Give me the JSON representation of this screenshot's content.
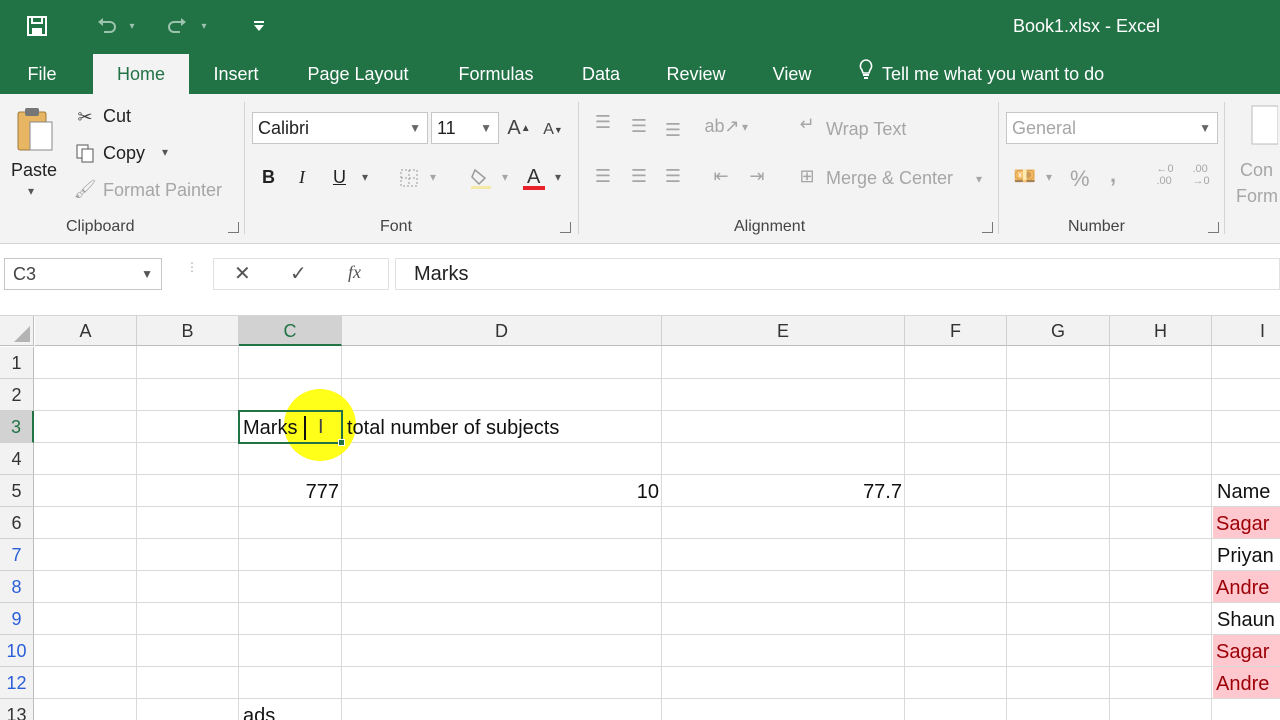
{
  "window": {
    "title": "Book1.xlsx - Excel"
  },
  "quick_access": {
    "save_icon": "save-icon",
    "undo_icon": "undo-icon",
    "redo_icon": "redo-icon",
    "customize_icon": "customize-qat-icon"
  },
  "tabs": [
    {
      "label": "File"
    },
    {
      "label": "Home"
    },
    {
      "label": "Insert"
    },
    {
      "label": "Page Layout"
    },
    {
      "label": "Formulas"
    },
    {
      "label": "Data"
    },
    {
      "label": "Review"
    },
    {
      "label": "View"
    }
  ],
  "tell_me": "Tell me what you want to do",
  "ribbon": {
    "clipboard": {
      "paste": "Paste",
      "cut": "Cut",
      "copy": "Copy",
      "format_painter": "Format Painter",
      "label": "Clipboard"
    },
    "font": {
      "name": "Calibri",
      "size": "11",
      "bold": "B",
      "italic": "I",
      "underline": "U",
      "label": "Font"
    },
    "alignment": {
      "wrap_text": "Wrap Text",
      "merge_center": "Merge & Center",
      "label": "Alignment"
    },
    "number": {
      "format": "General",
      "percent": "%",
      "comma": ",",
      "label": "Number"
    },
    "styles_partial": {
      "line1": "Con",
      "line2": "Form"
    }
  },
  "formula_bar": {
    "name_box": "C3",
    "cancel": "✕",
    "enter": "✓",
    "fx": "fx",
    "value": "Marks"
  },
  "grid": {
    "columns": [
      "A",
      "B",
      "C",
      "D",
      "E",
      "F",
      "G",
      "H",
      "I"
    ],
    "rows": [
      "1",
      "2",
      "3",
      "4",
      "5",
      "6",
      "7",
      "8",
      "9",
      "10",
      "12",
      "13"
    ],
    "selected_cell": "C3",
    "cells": {
      "C3": "Marks",
      "D3": "total number of subjects",
      "C5": "777",
      "D5": "10",
      "E5": "77.7",
      "I5": "Name",
      "I6": "Sagar",
      "I7": "Priyan",
      "I8": "Andre",
      "I9": "Shaun",
      "I10": "Sagar",
      "I12": "Andre",
      "C13": "ads"
    }
  },
  "colors": {
    "excel_green": "#217346",
    "highlight_pink": "#ffc7ce",
    "highlight_pink_text": "#9c0006",
    "cursor_highlight": "#ffff00"
  }
}
